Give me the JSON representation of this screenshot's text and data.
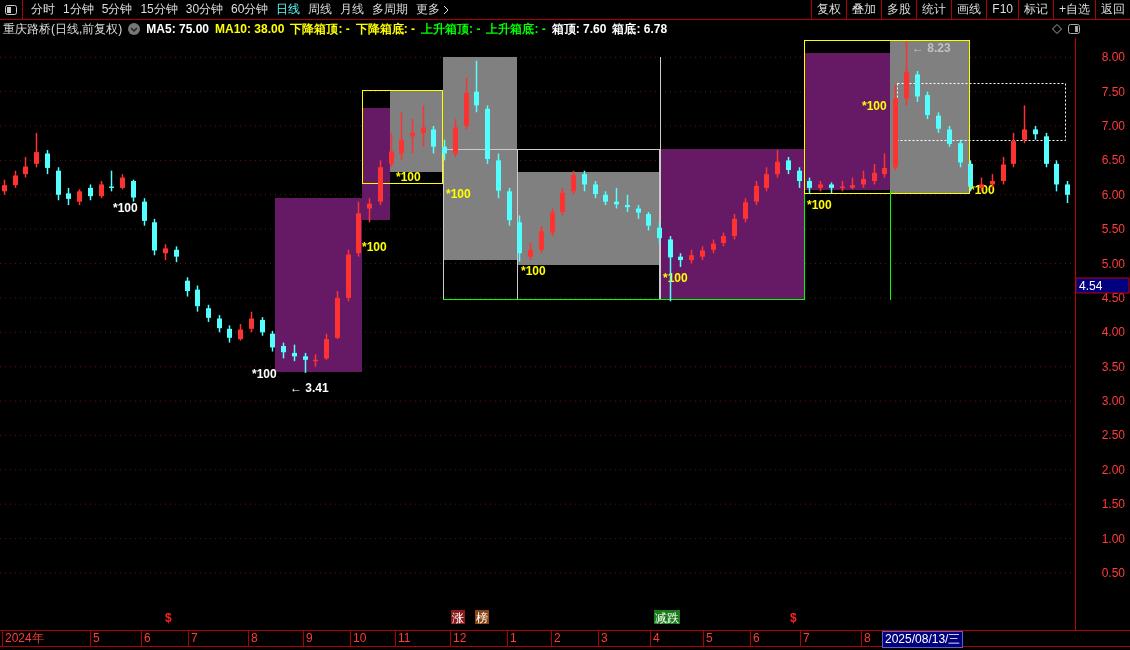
{
  "toolbar": {
    "periods": [
      {
        "label": "分时",
        "selected": false
      },
      {
        "label": "1分钟",
        "selected": false
      },
      {
        "label": "5分钟",
        "selected": false
      },
      {
        "label": "15分钟",
        "selected": false
      },
      {
        "label": "30分钟",
        "selected": false
      },
      {
        "label": "60分钟",
        "selected": false
      },
      {
        "label": "日线",
        "selected": true
      },
      {
        "label": "周线",
        "selected": false
      },
      {
        "label": "月线",
        "selected": false
      },
      {
        "label": "多周期",
        "selected": false
      }
    ],
    "more": "更多",
    "actions": [
      "复权",
      "叠加",
      "多股",
      "统计",
      "画线",
      "F10",
      "标记",
      "+自选",
      "返回"
    ]
  },
  "legend": {
    "title": "重庆路桥(日线,前复权)",
    "items": [
      {
        "text": "MA5: 75.00",
        "color": "#ffffff"
      },
      {
        "text": "MA10: 38.00",
        "color": "#ffff00"
      },
      {
        "text": "下降箱顶: -",
        "color": "#ffff00"
      },
      {
        "text": "下降箱底: -",
        "color": "#ffff00"
      },
      {
        "text": "上升箱顶: -",
        "color": "#00ff00"
      },
      {
        "text": "上升箱底: -",
        "color": "#00ff00"
      },
      {
        "text": "箱顶: 7.60",
        "color": "#ffffff"
      },
      {
        "text": "箱底: 6.78",
        "color": "#ffffff"
      }
    ]
  },
  "chart": {
    "chart_data": {
      "type": "candlestick",
      "ylim": [
        -0.33,
        8.28
      ],
      "grid": true,
      "yticks": [
        {
          "value": 8,
          "label": "8.00"
        },
        {
          "value": 7.5,
          "label": "7.50"
        },
        {
          "value": 7,
          "label": "7.00"
        },
        {
          "value": 6.5,
          "label": "6.50"
        },
        {
          "value": 6,
          "label": "6.00"
        },
        {
          "value": 5.5,
          "label": "5.50"
        },
        {
          "value": 5,
          "label": "5.00"
        },
        {
          "value": 4.5,
          "label": "4.50"
        },
        {
          "value": 4,
          "label": "4.00"
        },
        {
          "value": 3.5,
          "label": "3.50"
        },
        {
          "value": 3,
          "label": "3.00"
        },
        {
          "value": 2.5,
          "label": "2.50"
        },
        {
          "value": 2,
          "label": "2.00"
        },
        {
          "value": 1.5,
          "label": "1.50"
        },
        {
          "value": 1,
          "label": "1.00"
        },
        {
          "value": 0.5,
          "label": "0.50"
        }
      ],
      "ohlc": [
        [
          6.05,
          6.22,
          6.0,
          6.14
        ],
        [
          6.14,
          6.35,
          6.1,
          6.28
        ],
        [
          6.3,
          6.55,
          6.25,
          6.41
        ],
        [
          6.45,
          6.9,
          6.4,
          6.62
        ],
        [
          6.6,
          6.65,
          6.3,
          6.39
        ],
        [
          6.35,
          6.4,
          5.92,
          6.0
        ],
        [
          6.02,
          6.1,
          5.85,
          5.94
        ],
        [
          5.9,
          6.08,
          5.85,
          6.05
        ],
        [
          6.1,
          6.15,
          5.92,
          5.98
        ],
        [
          5.98,
          6.2,
          5.95,
          6.15
        ],
        [
          6.12,
          6.35,
          6.05,
          6.1
        ],
        [
          6.1,
          6.3,
          6.08,
          6.25
        ],
        [
          6.2,
          6.22,
          5.9,
          5.96
        ],
        [
          5.9,
          5.95,
          5.55,
          5.62
        ],
        [
          5.6,
          5.65,
          5.12,
          5.19
        ],
        [
          5.15,
          5.28,
          5.05,
          5.22
        ],
        [
          5.2,
          5.25,
          5.02,
          5.1
        ],
        [
          4.75,
          4.8,
          4.52,
          4.6
        ],
        [
          4.62,
          4.68,
          4.3,
          4.38
        ],
        [
          4.35,
          4.4,
          4.15,
          4.21
        ],
        [
          4.2,
          4.25,
          4.0,
          4.06
        ],
        [
          4.05,
          4.1,
          3.85,
          3.92
        ],
        [
          3.9,
          4.12,
          3.88,
          4.04
        ],
        [
          4.05,
          4.3,
          4.0,
          4.2
        ],
        [
          4.18,
          4.22,
          3.95,
          4.0
        ],
        [
          3.98,
          4.02,
          3.72,
          3.78
        ],
        [
          3.8,
          3.85,
          3.62,
          3.71
        ],
        [
          3.7,
          3.82,
          3.58,
          3.65
        ],
        [
          3.65,
          3.7,
          3.41,
          3.6
        ],
        [
          3.58,
          3.68,
          3.5,
          3.6
        ],
        [
          3.62,
          3.98,
          3.6,
          3.9
        ],
        [
          3.92,
          4.6,
          3.9,
          4.5
        ],
        [
          4.5,
          5.2,
          4.45,
          5.13
        ],
        [
          5.15,
          5.9,
          5.1,
          5.73
        ],
        [
          5.8,
          5.95,
          5.6,
          5.87
        ],
        [
          5.9,
          6.5,
          5.85,
          6.4
        ],
        [
          6.45,
          6.9,
          6.4,
          6.63
        ],
        [
          6.6,
          7.2,
          6.5,
          6.8
        ],
        [
          6.85,
          7.1,
          6.6,
          6.9
        ],
        [
          6.9,
          7.3,
          6.7,
          6.98
        ],
        [
          6.95,
          7.0,
          6.6,
          6.7
        ],
        [
          6.7,
          6.8,
          6.5,
          6.6
        ],
        [
          6.6,
          7.1,
          6.55,
          6.98
        ],
        [
          7.0,
          7.7,
          6.95,
          7.48
        ],
        [
          7.5,
          7.95,
          7.2,
          7.3
        ],
        [
          7.25,
          7.3,
          6.45,
          6.52
        ],
        [
          6.5,
          6.6,
          5.95,
          6.06
        ],
        [
          6.05,
          6.1,
          5.55,
          5.63
        ],
        [
          5.6,
          5.7,
          5.03,
          5.15
        ],
        [
          5.1,
          5.3,
          5.05,
          5.2
        ],
        [
          5.2,
          5.55,
          5.15,
          5.47
        ],
        [
          5.45,
          5.8,
          5.4,
          5.74
        ],
        [
          5.75,
          6.1,
          5.7,
          6.03
        ],
        [
          6.05,
          6.35,
          6.0,
          6.29
        ],
        [
          6.3,
          6.35,
          6.05,
          6.15
        ],
        [
          6.15,
          6.2,
          5.95,
          6.01
        ],
        [
          6.0,
          6.05,
          5.85,
          5.9
        ],
        [
          5.9,
          6.1,
          5.8,
          5.86
        ],
        [
          5.85,
          6.0,
          5.75,
          5.82
        ],
        [
          5.8,
          5.85,
          5.65,
          5.74
        ],
        [
          5.72,
          5.75,
          5.48,
          5.55
        ],
        [
          5.52,
          5.6,
          5.3,
          5.37
        ],
        [
          5.35,
          5.4,
          4.45,
          5.09
        ],
        [
          5.1,
          5.15,
          4.95,
          5.05
        ],
        [
          5.05,
          5.2,
          5.0,
          5.12
        ],
        [
          5.1,
          5.25,
          5.05,
          5.19
        ],
        [
          5.2,
          5.35,
          5.15,
          5.29
        ],
        [
          5.3,
          5.45,
          5.25,
          5.4
        ],
        [
          5.4,
          5.72,
          5.35,
          5.65
        ],
        [
          5.65,
          5.95,
          5.6,
          5.89
        ],
        [
          5.9,
          6.2,
          5.85,
          6.13
        ],
        [
          6.1,
          6.4,
          6.05,
          6.3
        ],
        [
          6.3,
          6.65,
          6.25,
          6.48
        ],
        [
          6.5,
          6.55,
          6.3,
          6.36
        ],
        [
          6.35,
          6.4,
          6.1,
          6.2
        ],
        [
          6.2,
          6.25,
          6.02,
          6.1
        ],
        [
          6.1,
          6.2,
          6.05,
          6.15
        ],
        [
          6.15,
          6.18,
          6.02,
          6.1
        ],
        [
          6.1,
          6.2,
          6.05,
          6.12
        ],
        [
          6.1,
          6.25,
          6.08,
          6.14
        ],
        [
          6.15,
          6.35,
          6.1,
          6.23
        ],
        [
          6.2,
          6.45,
          6.15,
          6.32
        ],
        [
          6.3,
          6.6,
          6.25,
          6.39
        ],
        [
          6.4,
          7.6,
          6.35,
          7.4
        ],
        [
          7.4,
          8.23,
          7.3,
          7.79
        ],
        [
          7.75,
          7.8,
          7.35,
          7.43
        ],
        [
          7.45,
          7.5,
          7.1,
          7.16
        ],
        [
          7.15,
          7.2,
          6.9,
          6.96
        ],
        [
          6.95,
          7.0,
          6.7,
          6.74
        ],
        [
          6.75,
          6.8,
          6.4,
          6.47
        ],
        [
          6.45,
          6.5,
          6.05,
          6.12
        ],
        [
          6.1,
          6.25,
          6.05,
          6.15
        ],
        [
          6.15,
          6.3,
          6.1,
          6.2
        ],
        [
          6.2,
          6.55,
          6.15,
          6.44
        ],
        [
          6.45,
          6.9,
          6.4,
          6.78
        ],
        [
          6.8,
          7.3,
          6.75,
          6.95
        ],
        [
          6.95,
          7.0,
          6.8,
          6.88
        ],
        [
          6.85,
          6.9,
          6.4,
          6.45
        ],
        [
          6.45,
          6.5,
          6.05,
          6.15
        ],
        [
          6.15,
          6.2,
          5.88,
          6.0
        ]
      ]
    },
    "annotations": [
      {
        "text": "*100",
        "color": "#ffffff"
      },
      {
        "text": "*100",
        "color": "#ffffff"
      },
      {
        "text": "← 3.41",
        "color": "#ffffff"
      },
      {
        "text": "*100",
        "color": "#ffff00"
      },
      {
        "text": "*100",
        "color": "#ffff00"
      },
      {
        "text": "*100",
        "color": "#ffff00"
      },
      {
        "text": "*100",
        "color": "#ffff00"
      },
      {
        "text": "*100",
        "color": "#ffff00"
      },
      {
        "text": "*100",
        "color": "#ffff00"
      },
      {
        "text": "← 8.23",
        "color": "#c0c0c0"
      },
      {
        "text": "*100",
        "color": "#ffff00"
      },
      {
        "text": "*100",
        "color": "#ffff00"
      }
    ],
    "markers": [
      {
        "text": "$",
        "kind": "symbol"
      },
      {
        "text": "涨",
        "kind": "tag",
        "color": "#8b1a1a"
      },
      {
        "text": "榜",
        "kind": "tag",
        "color": "#8b4513"
      },
      {
        "text": "减跌",
        "kind": "tag",
        "color": "#1a7a1a"
      },
      {
        "text": "$",
        "kind": "symbol"
      }
    ]
  },
  "price_axis": {
    "current": "4.54"
  },
  "time_axis": {
    "labels": [
      "2024年",
      "5",
      "6",
      "7",
      "8",
      "9",
      "10",
      "11",
      "12",
      "1",
      "2",
      "3",
      "4",
      "5",
      "6",
      "7",
      "8"
    ],
    "cursor": "2025/08/13/三"
  }
}
